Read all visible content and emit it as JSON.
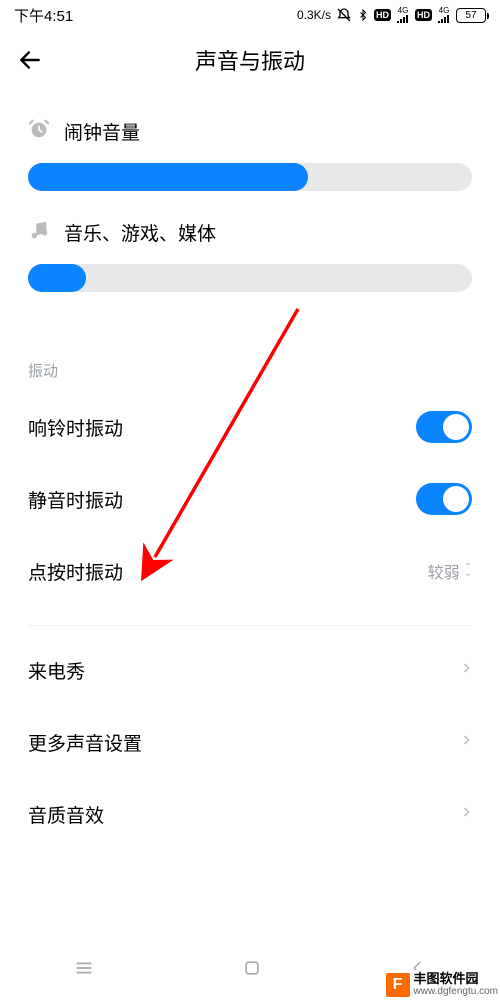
{
  "status": {
    "time": "下午4:51",
    "net_speed": "0.3K/s",
    "battery": "57"
  },
  "header": {
    "title": "声音与振动"
  },
  "volumes": {
    "alarm": {
      "label": "闹钟音量",
      "percent": 63
    },
    "media": {
      "label": "音乐、游戏、媒体",
      "percent": 13
    }
  },
  "vibration": {
    "section_label": "振动",
    "on_ring": {
      "label": "响铃时振动",
      "on": true
    },
    "on_silent": {
      "label": "静音时振动",
      "on": true
    },
    "on_tap": {
      "label": "点按时振动",
      "value": "较弱"
    }
  },
  "links": {
    "caller_show": "来电秀",
    "more_sound": "更多声音设置",
    "sound_effect": "音质音效"
  },
  "watermark": {
    "name": "丰图软件园",
    "url": "www.dgfengtu.com"
  }
}
